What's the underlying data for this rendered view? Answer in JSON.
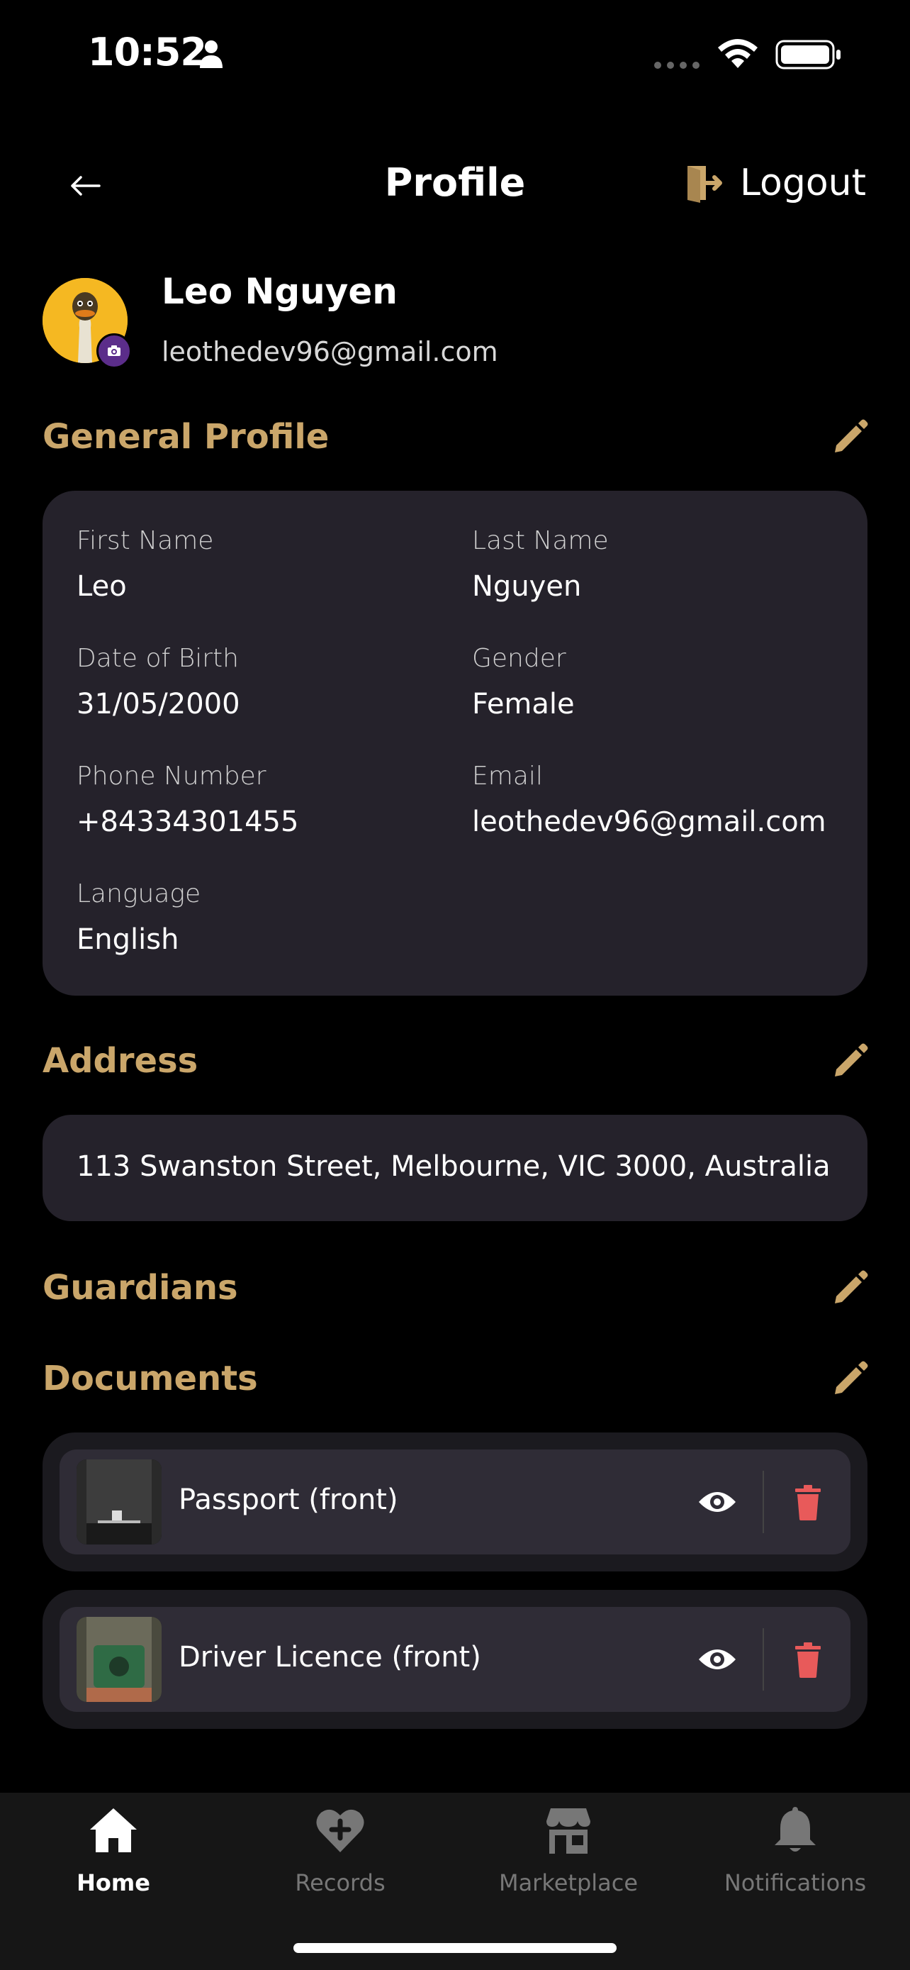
{
  "status_bar": {
    "time": "10:52"
  },
  "header": {
    "title": "Profile",
    "logout_label": "Logout"
  },
  "user": {
    "name": "Leo Nguyen",
    "email": "leothedev96@gmail.com"
  },
  "general_profile": {
    "title": "General Profile",
    "fields": [
      {
        "label": "First Name",
        "value": "Leo"
      },
      {
        "label": "Last Name",
        "value": "Nguyen"
      },
      {
        "label": "Date of  Birth",
        "value": "31/05/2000"
      },
      {
        "label": "Gender",
        "value": "Female"
      },
      {
        "label": "Phone Number",
        "value": "+84334301455"
      },
      {
        "label": "Email",
        "value": "leothedev96@gmail.com"
      },
      {
        "label": "Language",
        "value": "English"
      }
    ]
  },
  "address": {
    "title": "Address",
    "value": "113 Swanston Street, Melbourne, VIC 3000, Australia"
  },
  "guardians": {
    "title": "Guardians"
  },
  "documents": {
    "title": "Documents",
    "items": [
      {
        "label": "Passport (front)"
      },
      {
        "label": "Driver Licence (front)"
      }
    ]
  },
  "bottom_nav": {
    "items": [
      {
        "label": "Home",
        "icon": "home-icon",
        "active": true
      },
      {
        "label": "Records",
        "icon": "heart-plus-icon",
        "active": false
      },
      {
        "label": "Marketplace",
        "icon": "store-icon",
        "active": false
      },
      {
        "label": "Notifications",
        "icon": "bell-icon",
        "active": false
      }
    ]
  },
  "colors": {
    "accent": "#caa66a",
    "card": "#25222b",
    "delete": "#e85a5a",
    "avatar_bg": "#f5b822"
  }
}
